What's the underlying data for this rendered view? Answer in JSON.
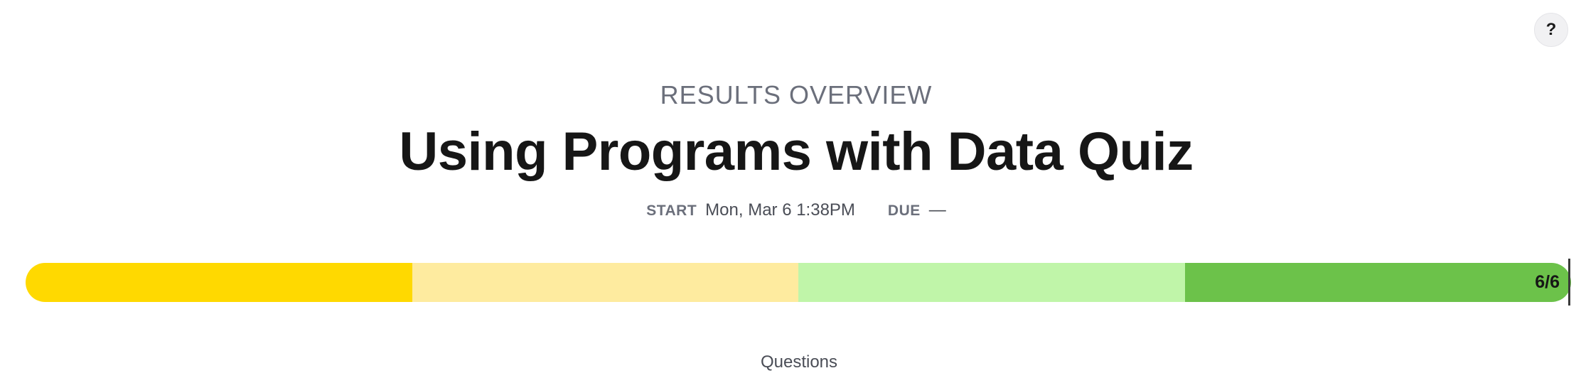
{
  "header": {
    "help_label": "?",
    "overline": "RESULTS OVERVIEW",
    "title": "Using Programs with Data Quiz"
  },
  "meta": {
    "start_label": "START",
    "start_value": "Mon, Mar 6 1:38PM",
    "due_label": "DUE",
    "due_value": "—"
  },
  "progress": {
    "count_text": "6/6",
    "completed": 6,
    "total": 6,
    "segments": [
      {
        "fraction": 0.25,
        "color": "#ffd900"
      },
      {
        "fraction": 0.25,
        "color": "#feeb9f"
      },
      {
        "fraction": 0.25,
        "color": "#c0f5a9"
      },
      {
        "fraction": 0.25,
        "color": "#6cc24a"
      }
    ]
  },
  "section": {
    "questions_label": "Questions"
  }
}
